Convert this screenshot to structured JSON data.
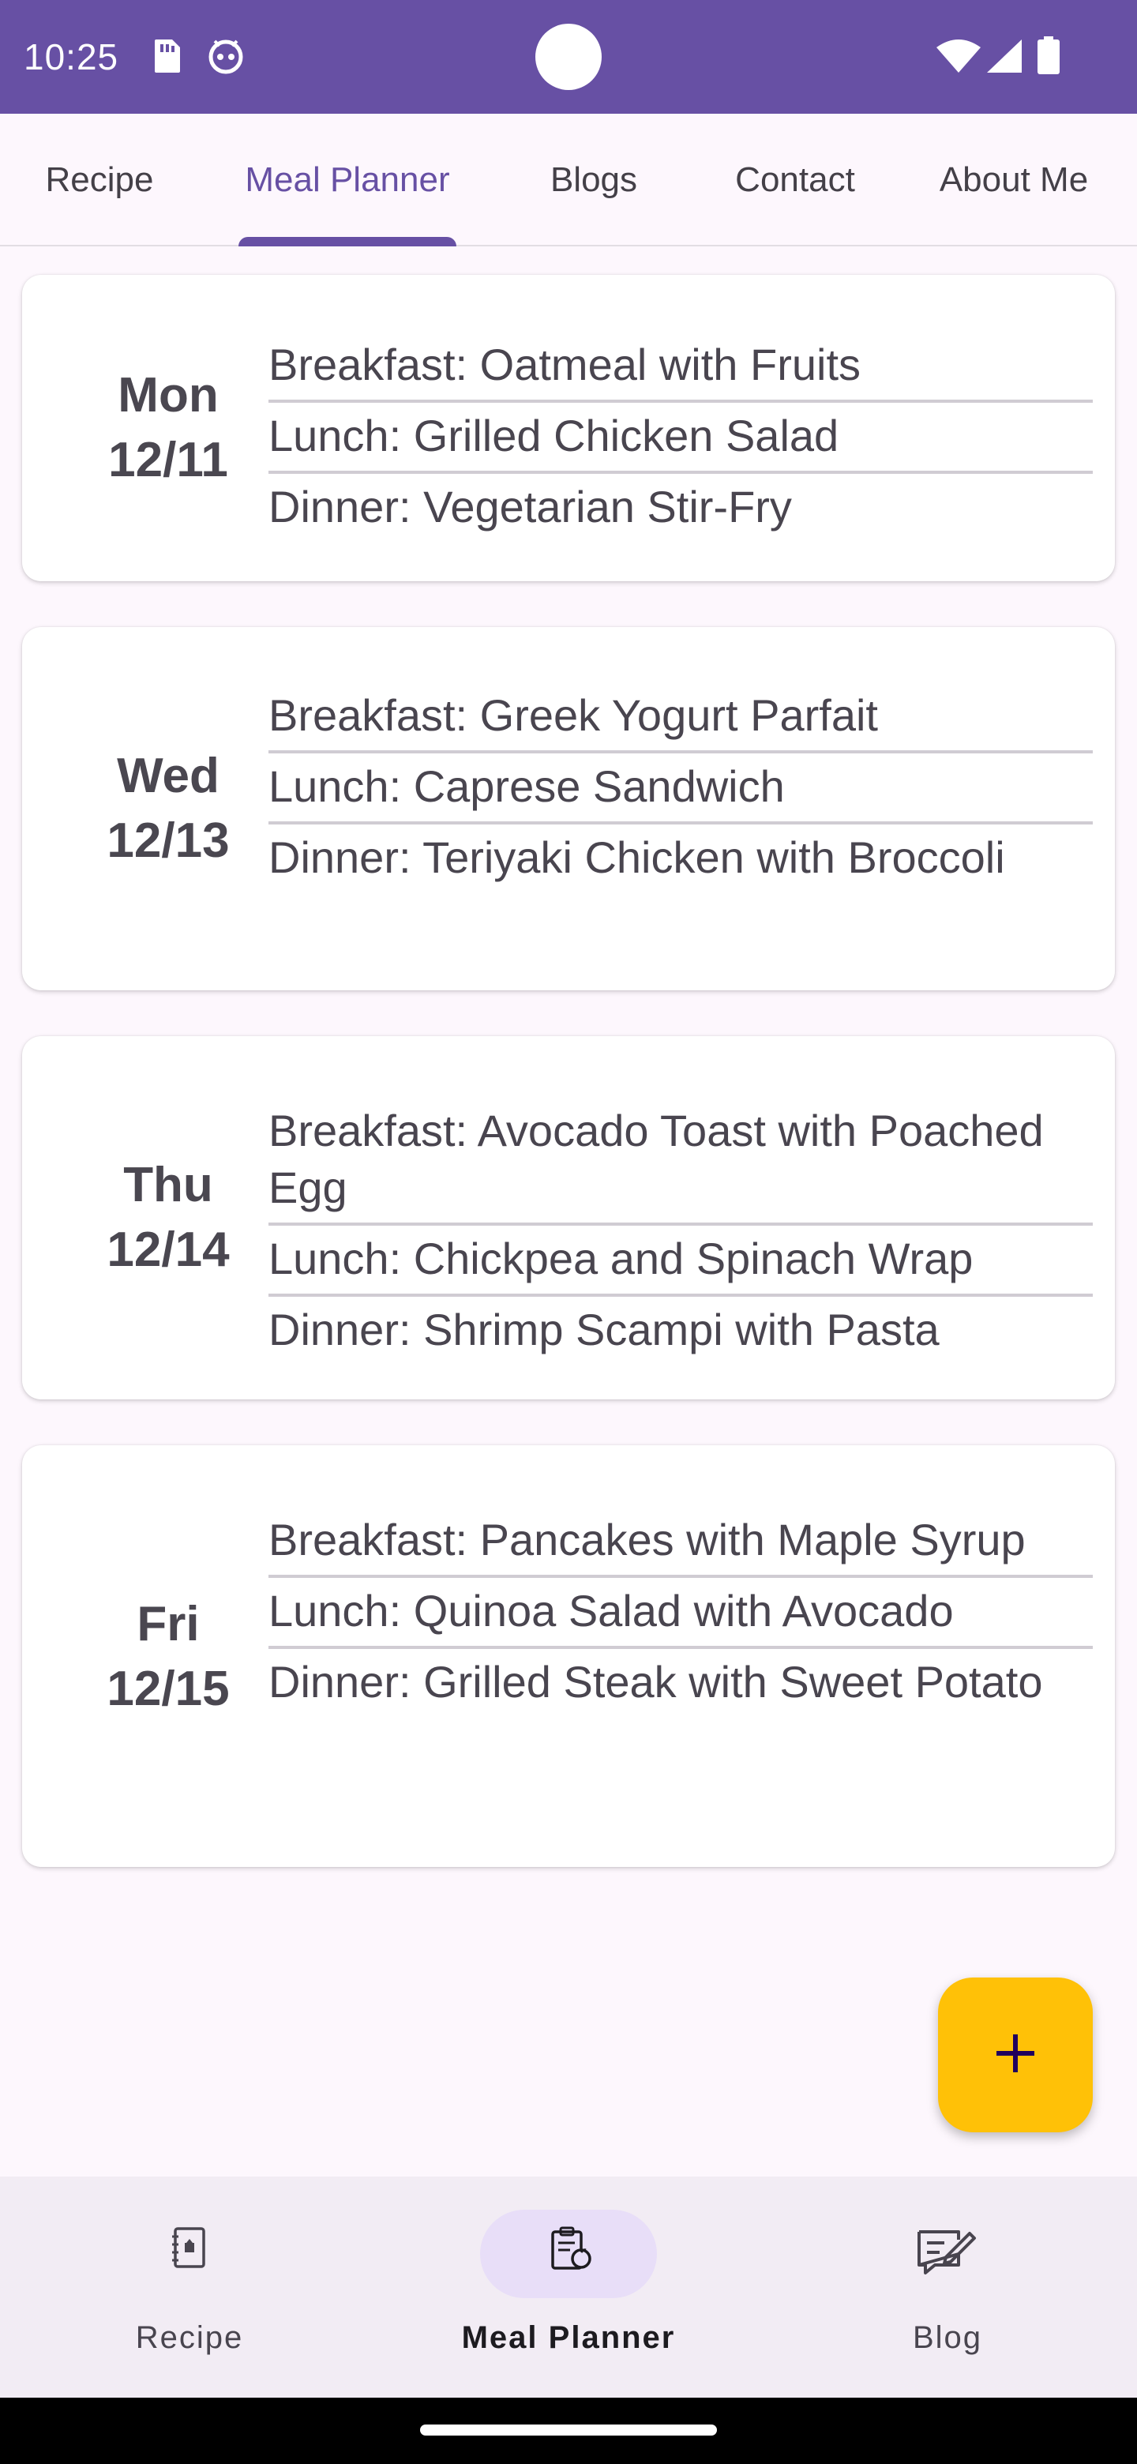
{
  "status_bar": {
    "time": "10:25",
    "icons": [
      "sd-card-icon",
      "android-debug-icon",
      "wifi-icon",
      "signal-icon",
      "battery-icon"
    ],
    "color": "#6750a4"
  },
  "tabs": [
    {
      "label": "Recipe",
      "active": false
    },
    {
      "label": "Meal Planner",
      "active": true
    },
    {
      "label": "Blogs",
      "active": false
    },
    {
      "label": "Contact",
      "active": false
    },
    {
      "label": "About Me",
      "active": false
    }
  ],
  "days": [
    {
      "day": "Mon",
      "date": "12/11",
      "meals": [
        "Breakfast: Oatmeal with Fruits",
        "Lunch: Grilled Chicken Salad",
        "Dinner: Vegetarian Stir-Fry"
      ]
    },
    {
      "day": "Wed",
      "date": "12/13",
      "meals": [
        "Breakfast: Greek Yogurt Parfait",
        "Lunch: Caprese Sandwich",
        "Dinner: Teriyaki Chicken with Broccoli"
      ]
    },
    {
      "day": "Thu",
      "date": "12/14",
      "meals": [
        "Breakfast: Avocado Toast with Poached Egg",
        "Lunch: Chickpea and Spinach Wrap",
        "Dinner: Shrimp Scampi with Pasta"
      ]
    },
    {
      "day": "Fri",
      "date": "12/15",
      "meals": [
        "Breakfast: Pancakes with Maple Syrup",
        "Lunch: Quinoa Salad with Avocado",
        "Dinner: Grilled Steak with Sweet Potato"
      ]
    }
  ],
  "fab": {
    "icon": "plus-icon",
    "color": "#ffc107"
  },
  "bottom_nav": [
    {
      "label": "Recipe",
      "icon": "recipe-book-icon",
      "active": false
    },
    {
      "label": "Meal Planner",
      "icon": "meal-planner-icon",
      "active": true
    },
    {
      "label": "Blog",
      "icon": "blog-edit-icon",
      "active": false
    }
  ]
}
